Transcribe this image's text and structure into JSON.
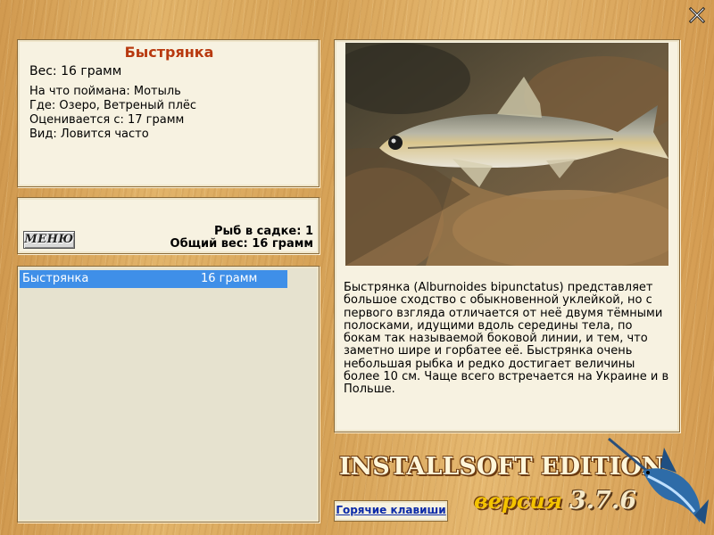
{
  "fish": {
    "name": "Быстрянка",
    "weight_line": "Вес: 16 грамм",
    "caught_with": "На что поймана: Мотыль",
    "location": "Где: Озеро, Ветреный плёс",
    "rated_from": "Оценивается с: 17 грамм",
    "species": "Вид: Ловится часто"
  },
  "summary": {
    "menu_label": "МЕНЮ",
    "fish_count": "Рыб в садке: 1",
    "total_weight": "Общий вес: 16 грамм"
  },
  "keepnet": [
    {
      "name": "Быстрянка",
      "weight": "16 грамм"
    }
  ],
  "description": "Быстрянка (Alburnoides bipunctatus) представляет большое сходство с обыкновенной уклейкой, но с первого взгляда отличается от неё двумя тёмными полосками, идущими вдоль середины тела, по бокам так называемой боковой линии, и тем, что заметно шире и горбатее её. Быстрянка очень небольшая рыбка и редко достигает величины более 10 см. Чаще всего встречается на Украине и в Польше.",
  "footer": {
    "hotkeys_label": "Горячие клавиши",
    "brand": "INSTALLSOFT EDITION",
    "version_word": "версия",
    "version_number": "3.7.6"
  },
  "icons": {
    "close": "close-icon",
    "fish_photo": "fish-photo",
    "logo": "marlin-logo-icon"
  },
  "colors": {
    "title": "#b8390f",
    "selection": "#3f8fe8",
    "link": "#0b2aa8",
    "panel": "#f7f2e1"
  }
}
